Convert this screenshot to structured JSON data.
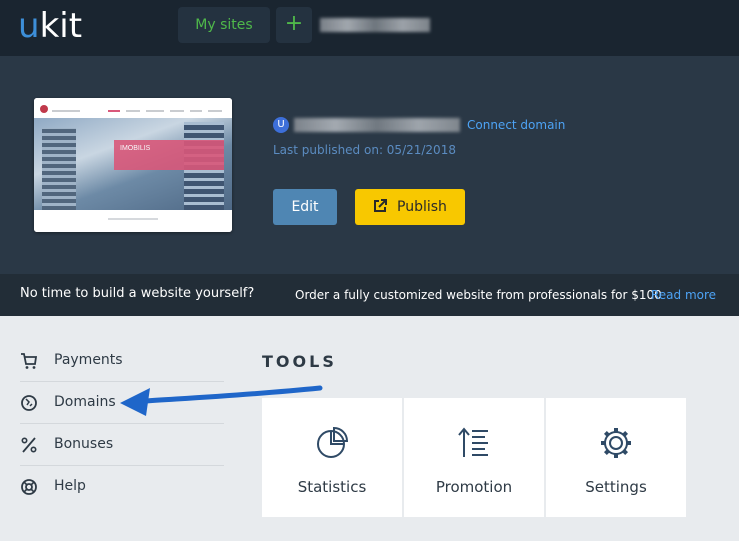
{
  "topbar": {
    "logo_u": "u",
    "logo_kit": "kit",
    "my_sites_label": "My sites",
    "add_label": "+"
  },
  "site": {
    "avatar_letter": "U",
    "connect_domain_label": "Connect domain",
    "last_published": "Last published on: 05/21/2018",
    "edit_label": "Edit",
    "publish_label": "Publish",
    "thumbnail_banner_text": "IMOBILIS"
  },
  "promo": {
    "question": "No time to build a website yourself?",
    "offer": "Order a fully customized website from professionals for $100",
    "read_more": "Read more"
  },
  "sidebar": {
    "items": [
      {
        "label": "Payments",
        "icon": "cart-icon"
      },
      {
        "label": "Domains",
        "icon": "domain-icon"
      },
      {
        "label": "Bonuses",
        "icon": "percent-icon"
      },
      {
        "label": "Help",
        "icon": "lifebuoy-icon"
      }
    ]
  },
  "tools": {
    "title": "TOOLS",
    "tiles": [
      {
        "label": "Statistics",
        "icon": "pie-chart-icon"
      },
      {
        "label": "Promotion",
        "icon": "sort-up-icon"
      },
      {
        "label": "Settings",
        "icon": "gear-icon"
      }
    ]
  },
  "colors": {
    "topbar": "#1a2530",
    "hero": "#2a3846",
    "accent_green": "#4fb84a",
    "link_blue": "#4da3f5",
    "edit_button": "#4f86b3",
    "publish_button": "#f8c800",
    "annotation_arrow": "#1f66c9"
  }
}
